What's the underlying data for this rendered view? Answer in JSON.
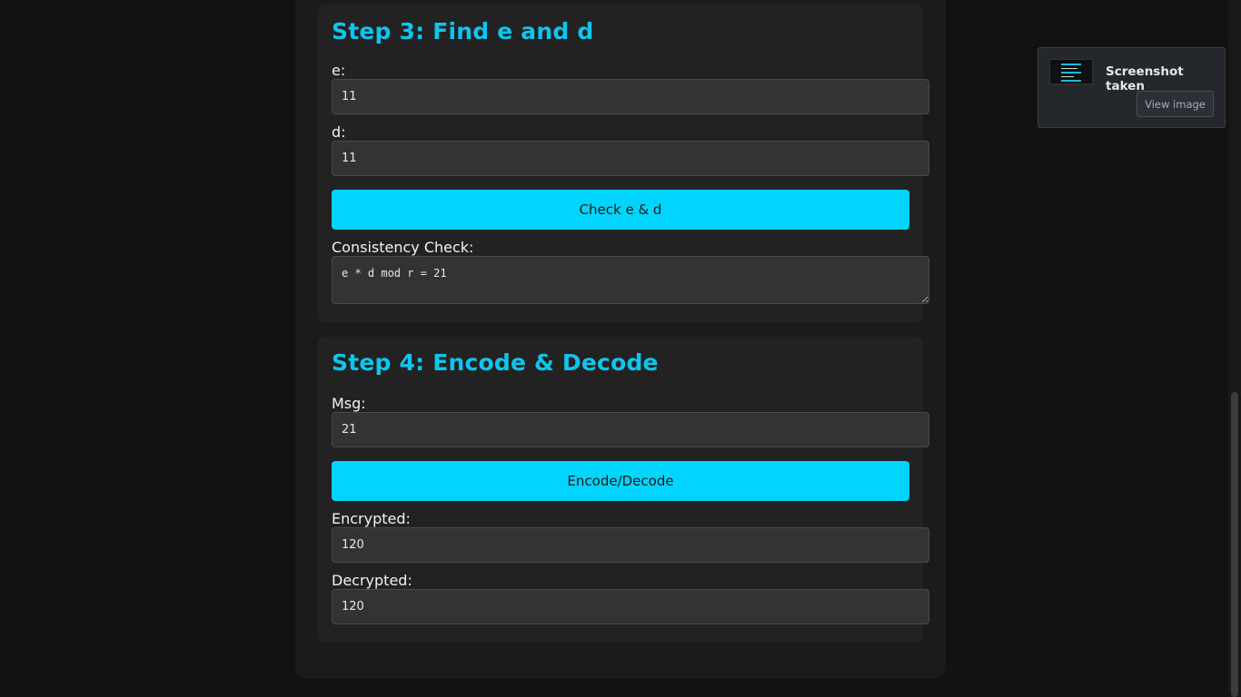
{
  "step3": {
    "title": "Step 3: Find e and d",
    "e_label": "e:",
    "e_value": "11",
    "d_label": "d:",
    "d_value": "11",
    "check_button": "Check e & d",
    "consistency_label": "Consistency Check:",
    "consistency_value": "e * d mod r = 21"
  },
  "step4": {
    "title": "Step 4: Encode & Decode",
    "msg_label": "Msg:",
    "msg_value": "21",
    "encode_button": "Encode/Decode",
    "encrypted_label": "Encrypted:",
    "encrypted_value": "120",
    "decrypted_label": "Decrypted:",
    "decrypted_value": "120"
  },
  "toast": {
    "title": "Screenshot taken",
    "view_button": "View image"
  },
  "colors": {
    "accent": "#00d4ff",
    "heading": "#0dc6ef",
    "background": "#121212",
    "card": "#222222"
  }
}
